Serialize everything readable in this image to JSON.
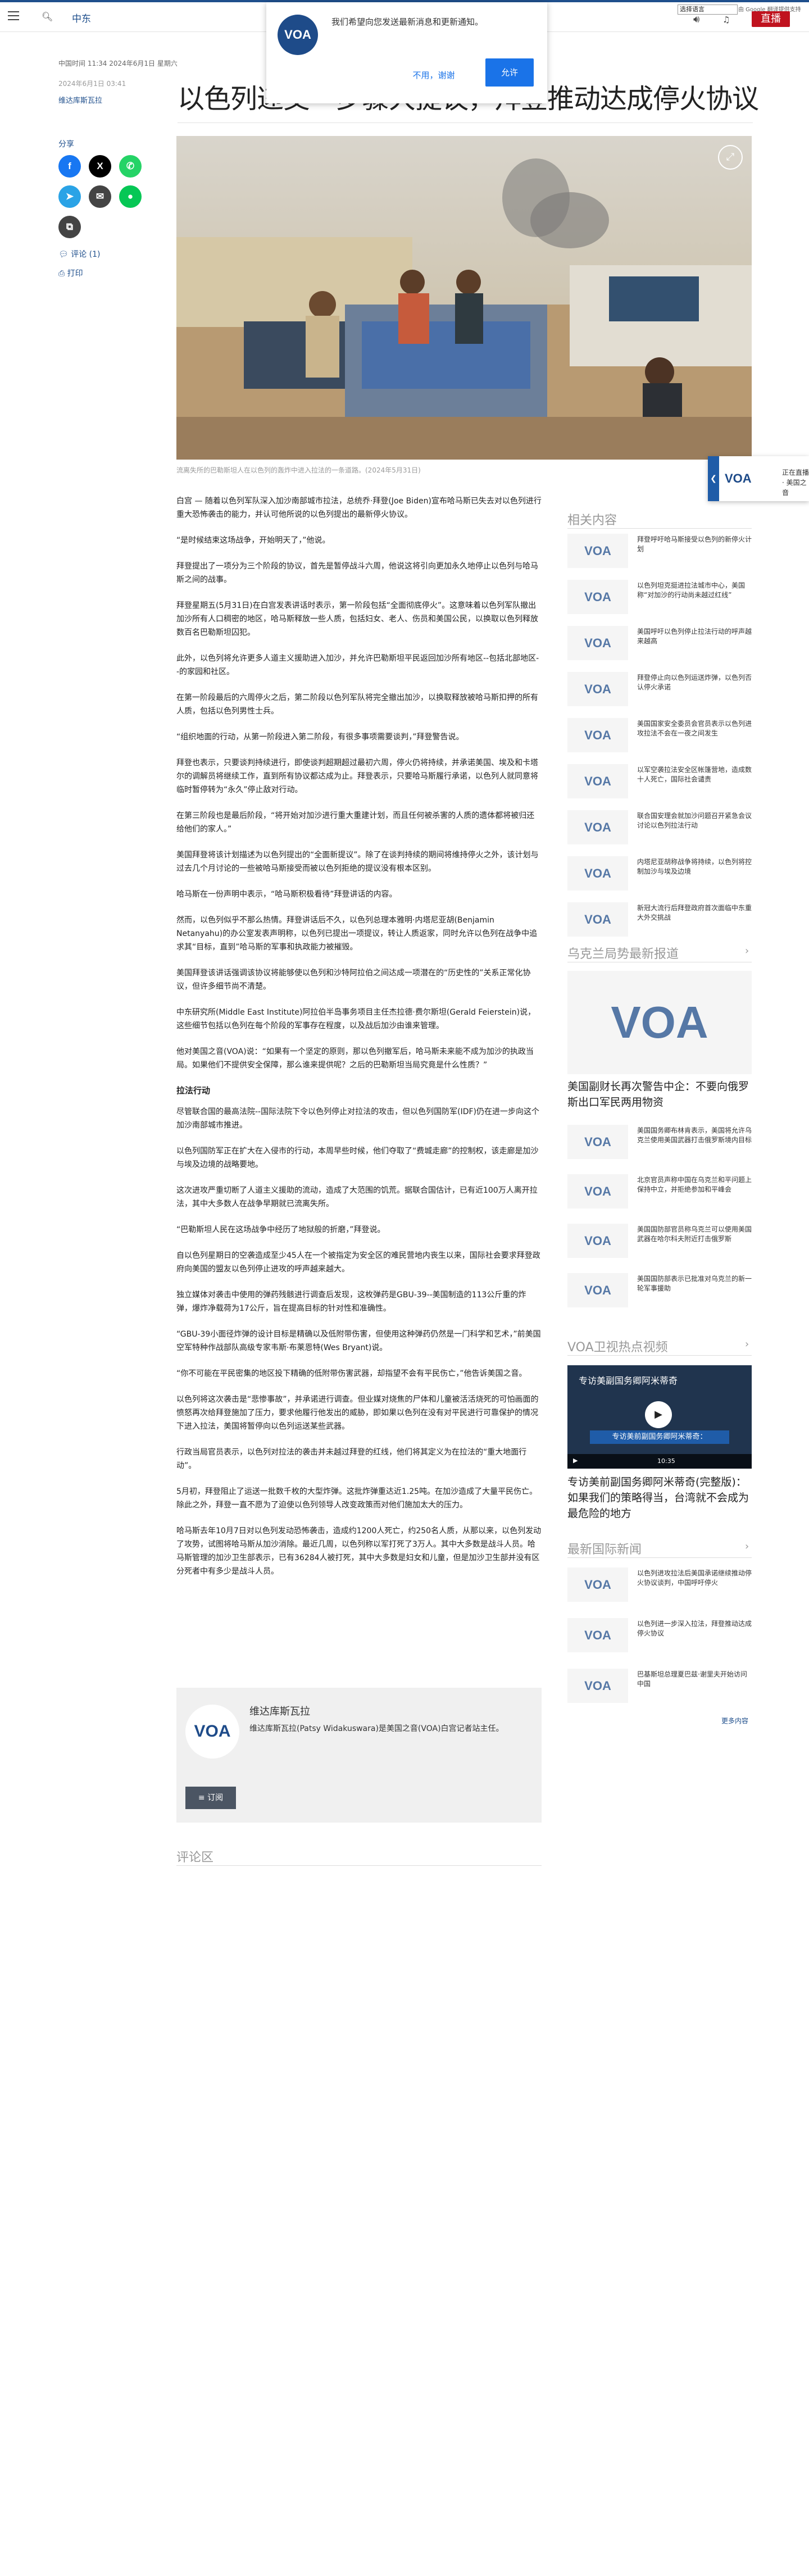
{
  "header": {
    "site_label": "中东",
    "language_select": "选择语言",
    "google_translate": "由 Google 翻译提供支持",
    "live_label": "直播"
  },
  "notification": {
    "logo": "VOA",
    "message": "我们希望向您发送最新消息和更新通知。",
    "decline": "不用，谢谢",
    "accept": "允许"
  },
  "article": {
    "datetime": "中国时间 11:34 2024年6月1日 星期六",
    "published": "2024年6月1日 03:41",
    "author": "维达库斯瓦拉",
    "headline": "以色列递交一步骤大提议，拜登推动达成停火协议",
    "caption": "流离失所的巴勒斯坦人在以色列的轰炸中进入拉法的一条道路。(2024年5月31日)",
    "share_label": "分享",
    "comments_link": "评论 (1)",
    "print_link": "打印",
    "paragraphs": [
      "白宫 — 随着以色列军队深入加沙南部城市拉法，总统乔·拜登(Joe Biden)宣布哈马斯已失去对以色列进行重大恐怖袭击的能力，并认可他所说的以色列提出的最新停火协议。",
      "“是时候结束这场战争，开始明天了，”他说。",
      "拜登提出了一项分为三个阶段的协议，首先是暂停战斗六周，他说这将引向更加永久地停止以色列与哈马斯之间的战事。",
      "拜登星期五(5月31日)在白宫发表讲话时表示，第一阶段包括“全面彻底停火”。这意味着以色列军队撤出加沙所有人口稠密的地区，哈马斯释放一些人质，包括妇女、老人、伤员和美国公民，以换取以色列释放数百名巴勒斯坦囚犯。",
      "此外，以色列将允许更多人道主义援助进入加沙，并允许巴勒斯坦平民返回加沙所有地区--包括北部地区--的家园和社区。",
      "在第一阶段最后的六周停火之后，第二阶段以色列军队将完全撤出加沙，以换取释放被哈马斯扣押的所有人质，包括以色列男性士兵。",
      "“组织地面的行动，从第一阶段进入第二阶段，有很多事项需要谈判，”拜登警告说。",
      "拜登也表示，只要谈判持续进行，即使谈判超期超过最初六周，停火仍将持续，并承诺美国、埃及和卡塔尔的调解员将继续工作，直到所有协议都达成为止。拜登表示，只要哈马斯履行承诺，以色列人就同意将临时暂停转为“永久”停止敌对行动。",
      "在第三阶段也是最后阶段，“将开始对加沙进行重大重建计划，而且任何被杀害的人质的遗体都将被归还给他们的家人。”",
      "美国拜登将该计划描述为以色列提出的“全面新提议”。除了在谈判持续的期间将维持停火之外，该计划与过去几个月讨论的一些被哈马斯接受而被以色列拒绝的提议没有根本区别。",
      "哈马斯在一份声明中表示，“哈马斯积极看待”拜登讲话的内容。",
      "然而，以色列似乎不那么热情。拜登讲话后不久，以色列总理本雅明·内塔尼亚胡(Benjamin Netanyahu)的办公室发表声明称，以色列已提出一项提议，转让人质返家，同时允许以色列在战争中追求其“目标，直到”哈马斯的军事和执政能力被摧毁。",
      "美国拜登该讲话强调该协议将能够使以色列和沙特阿拉伯之间达成一项潜在的“历史性的”关系正常化协议，但许多细节尚不清楚。",
      "中东研究所(Middle East Institute)阿拉伯半岛事务项目主任杰拉德·费尔斯坦(Gerald Feierstein)说，这些细节包括以色列在每个阶段的军事存在程度，以及战后加沙由谁来管理。",
      "他对美国之音(VOA)说：“如果有一个坚定的原则，那以色列撤军后，哈马斯未来能不成为加沙的执政当局。如果他们不提供安全保障，那么谁来提供呢？之后的巴勒斯坦当局究竟是什么性质？”"
    ],
    "subhead": "拉法行动",
    "paragraphs2": [
      "尽管联合国的最高法院--国际法院下令以色列停止对拉法的攻击，但以色列国防军(IDF)仍在进一步向这个加沙南部城市推进。",
      "以色列国防军正在扩大在入侵市的行动，本周早些时候，他们夺取了“费城走廊”的控制权，该走廊是加沙与埃及边境的战略要地。",
      "这次进攻严重切断了人道主义援助的流动，造成了大范围的饥荒。据联合国估计，已有近100万人离开拉法，其中大多数人在战争早期就已流离失所。",
      "“巴勒斯坦人民在这场战争中经历了地狱般的折磨，”拜登说。",
      "自以色列星期日的空袭造成至少45人在一个被指定为安全区的难民营地内丧生以来，国际社会要求拜登政府向美国的盟友以色列停止进攻的呼声越来越大。",
      "独立媒体对袭击中使用的弹药残骸进行调查后发现，这枚弹药是GBU-39--美国制造的113公斤重的炸弹，爆炸净载荷为17公斤，旨在提高目标的针对性和准确性。",
      "“GBU-39小面径炸弹的设计目标是精确以及低附带伤害，但使用这种弹药仍然是一门科学和艺术，”前美国空军特种作战部队高级专家韦斯·布莱恩特(Wes Bryant)说。",
      "“你不可能在平民密集的地区投下精确的低附带伤害武器，却指望不会有平民伤亡，”他告诉美国之音。",
      "以色列将这次袭击是“悲惨事故”，并承诺进行调查。但业媒对烧焦的尸体和儿童被活活烧死的可怕画面的愤怒再次给拜登施加了压力，要求他履行他发出的威胁，即如果以色列在没有对平民进行可靠保护的情况下进入拉法，美国将暂停向以色列运送某些武器。",
      "行政当局官员表示，以色列对拉法的袭击并未越过拜登的红线，他们将其定义为在拉法的“重大地面行动”。",
      "5月初，拜登阻止了运送一批数千枚的大型炸弹。这批炸弹重达近1.25吨。在加沙造成了大量平民伤亡。除此之外，拜登一直不愿为了迫使以色列领导人改变政策而对他们施加太大的压力。",
      "哈马斯去年10月7日对以色列发动恐怖袭击，造成约1200人死亡，约250名人质，从那以来，以色列发动了攻势，试图将哈马斯从加沙消除。最近几周，以色列称以军打死了3万人。其中大多数是战斗人员。哈马斯管理的加沙卫生部表示，已有36284人被打死，其中大多数是妇女和儿童，但是加沙卫生部并没有区分死者中有多少是战斗人员。"
    ]
  },
  "author_box": {
    "avatar": "VOA",
    "name": "维达库斯瓦拉",
    "bio": "维达库斯瓦拉(Patsy Widakuswara)是美国之音(VOA)白宫记者站主任。",
    "rss": "订阅"
  },
  "comments_heading": "评论区",
  "sidebar": {
    "related_title": "相关内容",
    "related": [
      "拜登呼吁哈马斯接受以色列的新停火计划",
      "以色列坦克挺进拉法城市中心，美国称“对加沙的行动尚未越过红线”",
      "美国呼吁以色列停止拉法行动的呼声越来越高",
      "拜登停止向以色列运送炸弹，以色列否认停火承诺",
      "美国国家安全委员会官员表示以色列进攻拉法不会在一夜之间发生",
      "以军空袭拉法安全区帐篷营地，造成数十人死亡，国际社会谴责",
      "联合国安理会就加沙问题召开紧急会议讨论以色列拉法行动",
      "内塔尼亚胡称战争将持续，以色列将控制加沙与埃及边境",
      "新冠大流行后拜登政府首次面临中东重大外交挑战"
    ],
    "ukraine_title": "乌克兰局势最新报道",
    "ukraine_big": "美国副财长再次警告中企：不要向俄罗斯出口军民两用物资",
    "ukraine": [
      "美国国务卿布林肯表示，美国将允许乌克兰使用美国武器打击俄罗斯境内目标",
      "北京官员声称中国在乌克兰和平问题上保持中立，并拒绝参加和平峰会",
      "美国国防部官员称乌克兰可以使用美国武器在哈尔科夫附近打击俄罗斯",
      "美国国防部表示已批准对乌克兰的新一轮军事援助"
    ],
    "video_section_title": "VOA卫视热点视频",
    "video_title": "专访美副国务卿阿米蒂奇",
    "video_banner": "专访美前副国务卿阿米蒂奇：",
    "video_time": "10:35",
    "video_caption": "专访美前副国务卿阿米蒂奇(完整版)：如果我们的策略得当，台湾就不会成为最危险的地方",
    "intl_title": "最新国际新闻",
    "intl": [
      "以色列进攻拉法后美国承诺继续推动停火协议谈判，中国呼吁停火",
      "以色列进一步深入拉法，拜登推动达成停火协议",
      "巴基斯坦总理夏巴兹·谢里夫开始访问中国"
    ],
    "more_label": "更多内容"
  },
  "floating_widget": {
    "logo": "VOA",
    "text": "正在直播 · 美国之音"
  }
}
